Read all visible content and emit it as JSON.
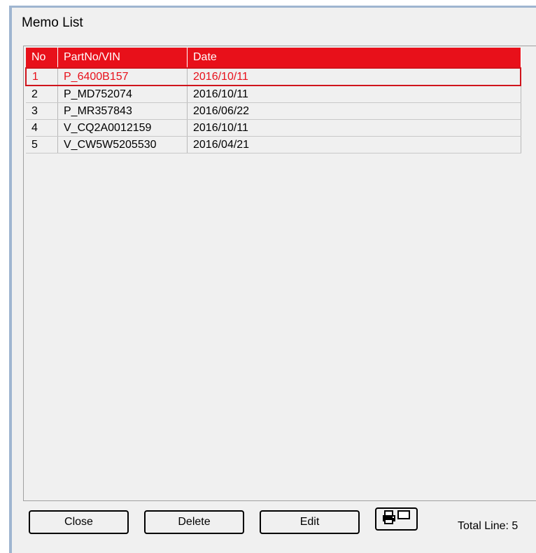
{
  "window": {
    "title": "Memo List"
  },
  "table": {
    "headers": {
      "no": "No",
      "part": "PartNo/VIN",
      "date": "Date"
    },
    "rows": [
      {
        "no": "1",
        "part": "P_6400B157",
        "date": "2016/10/11",
        "selected": true
      },
      {
        "no": "2",
        "part": "P_MD752074",
        "date": "2016/10/11",
        "selected": false
      },
      {
        "no": "3",
        "part": "P_MR357843",
        "date": "2016/06/22",
        "selected": false
      },
      {
        "no": "4",
        "part": "V_CQ2A0012159",
        "date": "2016/10/11",
        "selected": false
      },
      {
        "no": "5",
        "part": "V_CW5W5205530",
        "date": "2016/04/21",
        "selected": false
      }
    ]
  },
  "buttons": {
    "close": "Close",
    "delete": "Delete",
    "edit": "Edit",
    "print_icon": "printer-icon"
  },
  "footer": {
    "total_label": "Total Line: 5"
  },
  "colors": {
    "header_red": "#e8101a",
    "selection_red": "#d0141c",
    "background": "#f0f0f0"
  }
}
